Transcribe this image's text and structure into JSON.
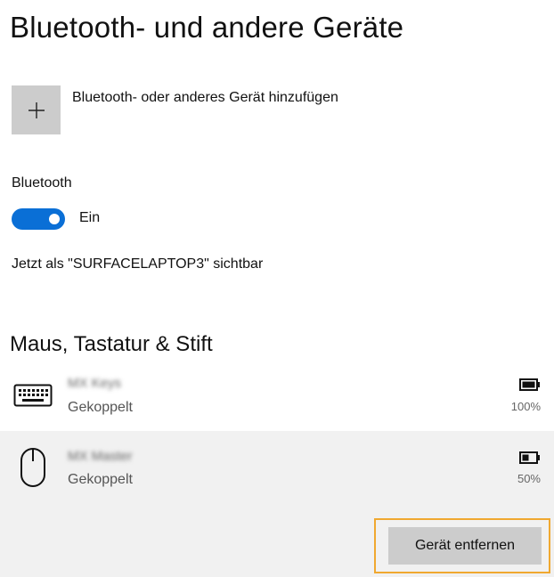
{
  "page": {
    "title": "Bluetooth- und andere Geräte"
  },
  "add_device": {
    "label": "Bluetooth- oder anderes Gerät hinzufügen",
    "icon": "plus-icon"
  },
  "bluetooth": {
    "label": "Bluetooth",
    "toggle_on": true,
    "state_label": "Ein",
    "visible_as": "Jetzt als \"SURFACELAPTOP3\" sichtbar",
    "accent_color": "#0a6fd6"
  },
  "mouse_keyboard_pen": {
    "heading": "Maus, Tastatur & Stift",
    "devices": [
      {
        "name": "MX Keys",
        "status": "Gekoppelt",
        "battery": "100%",
        "battery_level": 1.0,
        "icon": "keyboard-icon",
        "selected": false
      },
      {
        "name": "MX Master",
        "status": "Gekoppelt",
        "battery": "50%",
        "battery_level": 0.5,
        "icon": "mouse-icon",
        "selected": true
      }
    ],
    "remove_button_label": "Gerät entfernen",
    "highlight_color": "#f0a830"
  }
}
